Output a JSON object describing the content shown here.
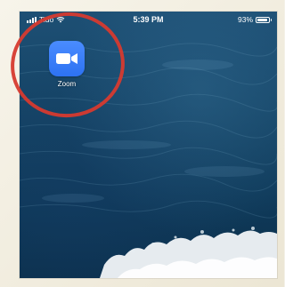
{
  "status_bar": {
    "carrier": "Tido",
    "time": "5:39 PM",
    "battery_percent": "93%",
    "battery_level": 0.93
  },
  "home_screen": {
    "apps": [
      {
        "label": "Zoom",
        "icon": "video-camera-icon",
        "color": "#2d72f2"
      }
    ]
  },
  "annotation": {
    "highlight_color": "#d63a2f"
  }
}
